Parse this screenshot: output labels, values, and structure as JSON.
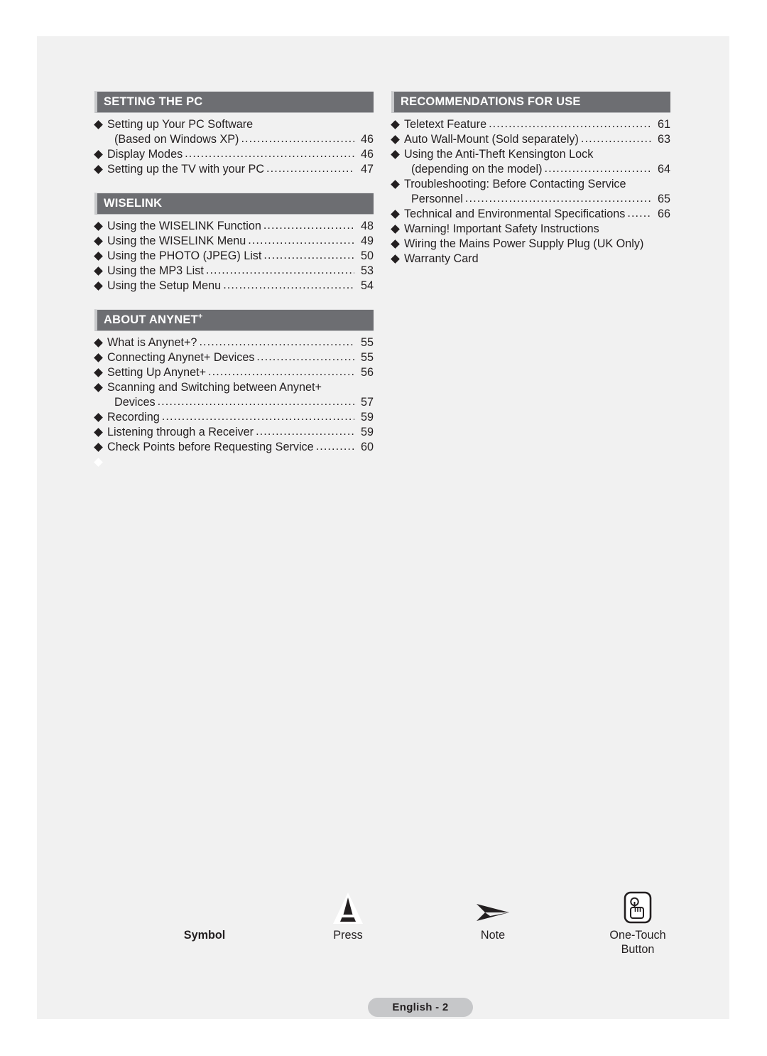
{
  "page": {
    "badge_label": "English - 2"
  },
  "columns": {
    "left": [
      {
        "title": "SETTING THE PC",
        "title_sup": "",
        "items": [
          {
            "bullet": "solid",
            "lines": [
              {
                "label": "Setting up Your PC Software",
                "leader": false,
                "page": ""
              },
              {
                "label": "(Based on Windows XP)",
                "indent": true,
                "leader": true,
                "page": "46"
              }
            ]
          },
          {
            "bullet": "solid",
            "lines": [
              {
                "label": "Display Modes",
                "leader": true,
                "page": "46"
              }
            ]
          },
          {
            "bullet": "solid",
            "lines": [
              {
                "label": "Setting up the TV with your PC",
                "leader": true,
                "page": "47"
              }
            ]
          }
        ]
      },
      {
        "title": "WISELINK",
        "title_sup": "",
        "items": [
          {
            "bullet": "solid",
            "lines": [
              {
                "label": "Using the WISELINK Function",
                "leader": true,
                "page": "48"
              }
            ]
          },
          {
            "bullet": "solid",
            "lines": [
              {
                "label": "Using the WISELINK Menu",
                "leader": true,
                "page": "49"
              }
            ]
          },
          {
            "bullet": "solid",
            "lines": [
              {
                "label": "Using the PHOTO (JPEG) List",
                "leader": true,
                "page": "50"
              }
            ]
          },
          {
            "bullet": "solid",
            "lines": [
              {
                "label": "Using the MP3 List",
                "leader": true,
                "page": "53"
              }
            ]
          },
          {
            "bullet": "solid",
            "lines": [
              {
                "label": "Using the Setup Menu",
                "leader": true,
                "page": "54"
              }
            ]
          }
        ]
      },
      {
        "title": "ABOUT ANYNET",
        "title_sup": "+",
        "items": [
          {
            "bullet": "solid",
            "lines": [
              {
                "label": "What is Anynet+?",
                "leader": true,
                "page": "55"
              }
            ]
          },
          {
            "bullet": "solid",
            "lines": [
              {
                "label": "Connecting Anynet+ Devices",
                "leader": true,
                "page": "55"
              }
            ]
          },
          {
            "bullet": "solid",
            "lines": [
              {
                "label": "Setting Up Anynet+",
                "leader": true,
                "page": "56"
              }
            ]
          },
          {
            "bullet": "solid",
            "lines": [
              {
                "label": "Scanning and Switching between Anynet+",
                "leader": false,
                "page": ""
              },
              {
                "label": "Devices",
                "indent": true,
                "leader": true,
                "page": "57"
              }
            ]
          },
          {
            "bullet": "solid",
            "lines": [
              {
                "label": "Recording",
                "leader": true,
                "page": "59"
              }
            ]
          },
          {
            "bullet": "solid",
            "lines": [
              {
                "label": "Listening through a Receiver",
                "leader": true,
                "page": "59"
              }
            ]
          },
          {
            "bullet": "solid",
            "lines": [
              {
                "label": "Check Points before Requesting Service",
                "leader": true,
                "page": "60"
              }
            ]
          },
          {
            "bullet": "empty",
            "lines": [
              {
                "label": "",
                "leader": false,
                "page": ""
              }
            ]
          }
        ]
      }
    ],
    "right": [
      {
        "title": "RECOMMENDATIONS FOR USE",
        "title_sup": "",
        "items": [
          {
            "bullet": "solid",
            "lines": [
              {
                "label": "Teletext Feature",
                "leader": true,
                "page": "61"
              }
            ]
          },
          {
            "bullet": "solid",
            "lines": [
              {
                "label": "Auto Wall-Mount (Sold separately)",
                "leader": true,
                "page": "63"
              }
            ]
          },
          {
            "bullet": "solid",
            "lines": [
              {
                "label": "Using the Anti-Theft Kensington Lock",
                "leader": false,
                "page": ""
              },
              {
                "label": "(depending on the model)",
                "indent": true,
                "leader": true,
                "page": "64"
              }
            ]
          },
          {
            "bullet": "solid",
            "lines": [
              {
                "label": "Troubleshooting: Before Contacting Service",
                "leader": false,
                "page": ""
              },
              {
                "label": "Personnel",
                "indent": true,
                "leader": true,
                "page": "65"
              }
            ]
          },
          {
            "bullet": "solid",
            "lines": [
              {
                "label": "Technical and Environmental Specifications",
                "leader": true,
                "page": "66"
              }
            ]
          },
          {
            "bullet": "solid",
            "lines": [
              {
                "label": "Warning! Important Safety Instructions",
                "leader": false,
                "page": ""
              }
            ]
          },
          {
            "bullet": "solid",
            "lines": [
              {
                "label": "Wiring the Mains Power Supply Plug (UK Only)",
                "leader": false,
                "page": ""
              }
            ]
          },
          {
            "bullet": "solid",
            "lines": [
              {
                "label": "Warranty Card",
                "leader": false,
                "page": ""
              }
            ]
          }
        ]
      }
    ]
  },
  "legend": [
    {
      "icon": "none",
      "label": "Symbol",
      "bold": true
    },
    {
      "icon": "press-triangle-icon",
      "label": "Press",
      "bold": false
    },
    {
      "icon": "note-arrow-icon",
      "label": "Note",
      "bold": false
    },
    {
      "icon": "one-touch-button-icon",
      "label": "One-Touch\nButton",
      "bold": false
    }
  ],
  "colors": {
    "page_background": "#f1f1f1",
    "section_header_bar": "#6d6e72",
    "section_header_accent": "#c8c9cb",
    "text": "#231f20",
    "badge_background": "#c6c7c9"
  }
}
